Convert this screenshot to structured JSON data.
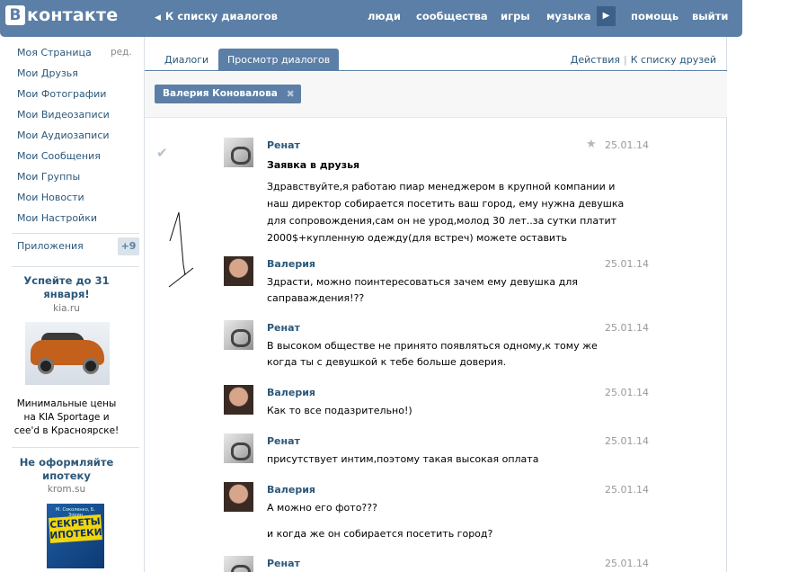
{
  "header": {
    "logo_letter": "В",
    "logo_text": "контакте",
    "back_link": "К списку диалогов",
    "nav": [
      "люди",
      "сообщества",
      "игры",
      "музыка",
      "помощь",
      "выйти"
    ]
  },
  "sidebar": {
    "items": [
      {
        "label": "Моя Страница"
      },
      {
        "label": "Мои Друзья"
      },
      {
        "label": "Мои Фотографии"
      },
      {
        "label": "Мои Видеозаписи"
      },
      {
        "label": "Мои Аудиозаписи"
      },
      {
        "label": "Мои Сообщения"
      },
      {
        "label": "Мои Группы"
      },
      {
        "label": "Мои Новости"
      },
      {
        "label": "Мои Настройки"
      }
    ],
    "edit_label": "ред.",
    "apps_label": "Приложения",
    "apps_badge": "+9"
  },
  "ads": [
    {
      "title": "Успейте до 31 января!",
      "domain": "kia.ru",
      "text": "Минимальные цены на KIA Sportage и cee'd в Красноярске!"
    },
    {
      "title": "Не оформляйте ипотеку",
      "domain": "krom.su",
      "book_author": "М. Соколенко, Б. Зорин",
      "book_title": "СЕКРЕТЫ ИПОТЕКИ"
    }
  ],
  "tabs": [
    {
      "label": "Диалоги",
      "active": false
    },
    {
      "label": "Просмотр диалогов",
      "active": true
    }
  ],
  "top_links": {
    "actions": "Действия",
    "separator": "|",
    "to_friends": "К списку друзей"
  },
  "filter": {
    "chip": "Валерия Коновалова"
  },
  "messages": [
    {
      "sender": "Ренат",
      "date": "25.01.14",
      "subject": "Заявка в друзья",
      "lines": [
        "Здравствуйте,я работаю пиар менеджером в крупной компании и",
        "наш директор собирается посетить ваш город, ему нужна девушка",
        "для сопровождения,сам он не урод,молод 30 лет..за сутки платит",
        "2000$+купленную одежду(для встреч) можете оставить"
      ]
    },
    {
      "sender": "Валерия",
      "date": "25.01.14",
      "lines": [
        "Здрасти, можно поинтересоваться зачем ему девушка для",
        "саправаждения!??"
      ]
    },
    {
      "sender": "Ренат",
      "date": "25.01.14",
      "lines": [
        "В высоком обществе не принято появляться одному,к тому же",
        "когда ты с девушкой к тебе больше доверия."
      ]
    },
    {
      "sender": "Валерия",
      "date": "25.01.14",
      "lines": [
        "Как то все подазрительно!)"
      ]
    },
    {
      "sender": "Ренат",
      "date": "25.01.14",
      "lines": [
        "присутствует интим,поэтому такая высокая оплата"
      ]
    },
    {
      "sender": "Валерия",
      "date": "25.01.14",
      "lines": [
        "А можно его фото???",
        "и когда же он собирается посетить город?"
      ]
    },
    {
      "sender": "Ренат",
      "date": "25.01.14",
      "lines": []
    }
  ]
}
